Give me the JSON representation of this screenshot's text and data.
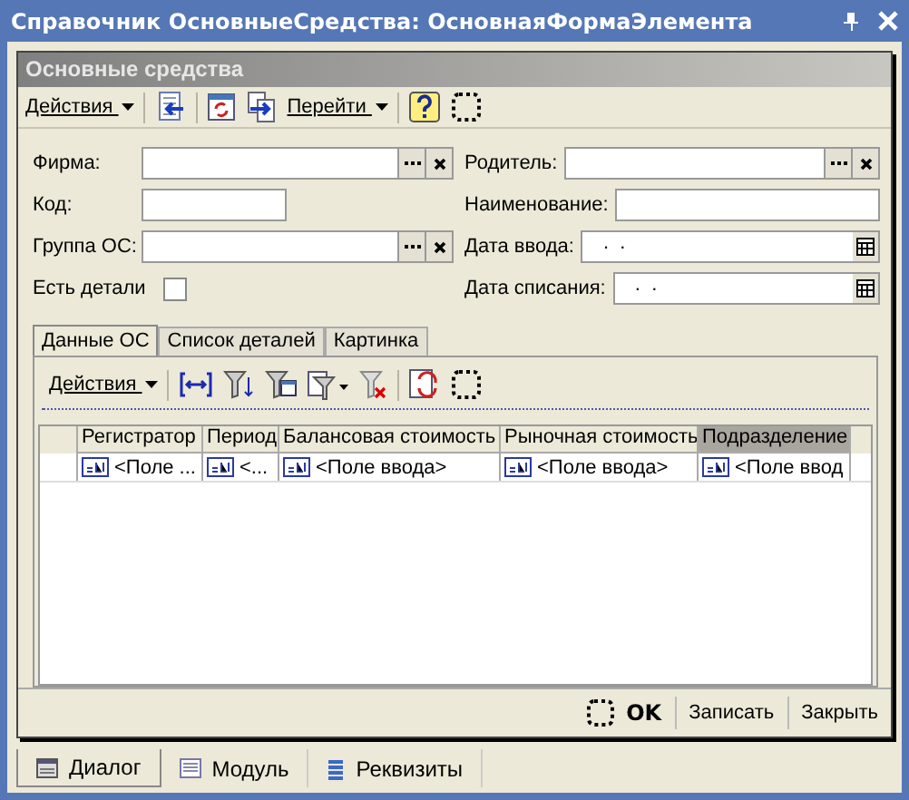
{
  "window": {
    "title": "Справочник ОсновныеСредства: ОсновнаяФормаЭлемента"
  },
  "form": {
    "title": "Основные средства"
  },
  "toolbar": {
    "actions": "Действия",
    "goto": "Перейти"
  },
  "rows": [
    {
      "left": {
        "kind": "ref",
        "label": "Фирма:"
      },
      "right": {
        "kind": "ref",
        "label": "Родитель:"
      }
    },
    {
      "left": {
        "kind": "text",
        "label": "Код:"
      },
      "right": {
        "kind": "text",
        "label": "Наименование:"
      }
    },
    {
      "left": {
        "kind": "ref",
        "label": "Группа ОС:"
      },
      "right": {
        "kind": "date",
        "label": "Дата ввода:",
        "value": " .  ."
      }
    },
    {
      "left": {
        "kind": "checkbox",
        "label": "Есть детали",
        "checked": false
      },
      "right": {
        "kind": "date",
        "label": "Дата списания:",
        "value": " .  ."
      }
    }
  ],
  "tabs": [
    {
      "label": "Данные ОС",
      "selected": true
    },
    {
      "label": "Список деталей",
      "selected": false
    },
    {
      "label": "Картинка",
      "selected": false
    }
  ],
  "table": {
    "actions": "Действия",
    "columns": [
      {
        "label": "Регистратор",
        "selected": false
      },
      {
        "label": "Период",
        "selected": false
      },
      {
        "label": "Балансовая стоимость",
        "selected": false
      },
      {
        "label": "Рыночная стоимость",
        "selected": false
      },
      {
        "label": "Подразделение",
        "selected": true
      }
    ],
    "rows": [
      [
        "<Поле ...",
        "<...",
        "<Поле ввода>",
        "<Поле ввода>",
        "<Поле ввод"
      ]
    ]
  },
  "buttons": [
    {
      "label": "OK",
      "kind": "default"
    },
    {
      "label": "Записать",
      "kind": "normal"
    },
    {
      "label": "Закрыть",
      "kind": "normal"
    }
  ],
  "bottom_tabs": [
    {
      "label": "Диалог",
      "selected": true
    },
    {
      "label": "Модуль",
      "selected": false
    },
    {
      "label": "Реквизиты",
      "selected": false
    }
  ]
}
